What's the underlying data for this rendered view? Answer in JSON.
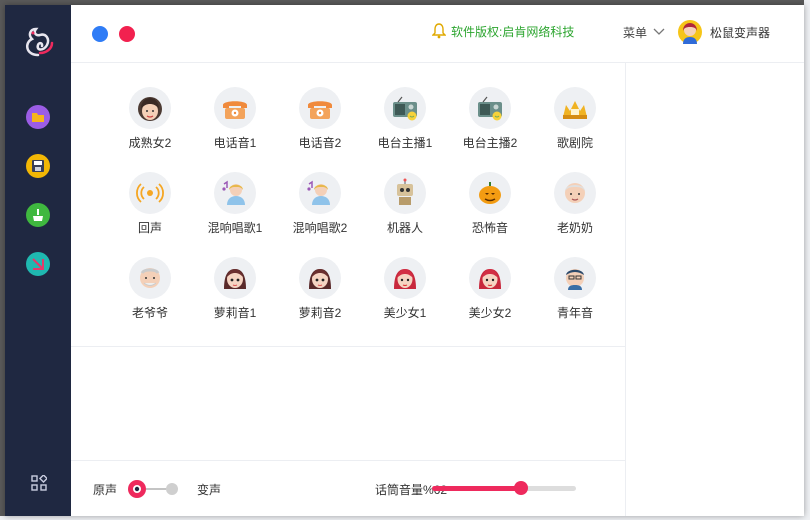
{
  "window": {
    "title": "松鼠变声器"
  },
  "titlebar": {
    "copyright": "软件版权:启肯网络科技",
    "menu_label": "菜单",
    "user_name": "松鼠变声器"
  },
  "sidebar": {
    "items": [
      {
        "name": "folder",
        "icon": "folder-icon",
        "color": "#9b5de5"
      },
      {
        "name": "save",
        "icon": "save-icon",
        "color": "#f2b705"
      },
      {
        "name": "clean",
        "icon": "broom-icon",
        "color": "#3fb83f"
      },
      {
        "name": "map",
        "icon": "map-icon",
        "color": "#1fb8b0"
      }
    ]
  },
  "effects": [
    {
      "label": "成熟女2",
      "icon": "woman-face-icon"
    },
    {
      "label": "电话音1",
      "icon": "telephone-icon"
    },
    {
      "label": "电话音2",
      "icon": "telephone-icon"
    },
    {
      "label": "电台主播1",
      "icon": "radio-icon"
    },
    {
      "label": "电台主播2",
      "icon": "radio-icon"
    },
    {
      "label": "歌剧院",
      "icon": "opera-house-icon"
    },
    {
      "label": "回声",
      "icon": "echo-icon"
    },
    {
      "label": "混响唱歌1",
      "icon": "singer-icon"
    },
    {
      "label": "混响唱歌2",
      "icon": "singer-icon"
    },
    {
      "label": "机器人",
      "icon": "robot-icon"
    },
    {
      "label": "恐怖音",
      "icon": "pumpkin-icon"
    },
    {
      "label": "老奶奶",
      "icon": "grandma-icon"
    },
    {
      "label": "老爷爷",
      "icon": "grandpa-icon"
    },
    {
      "label": "萝莉音1",
      "icon": "girl-icon"
    },
    {
      "label": "萝莉音2",
      "icon": "girl-icon"
    },
    {
      "label": "美少女1",
      "icon": "pretty-girl-icon"
    },
    {
      "label": "美少女2",
      "icon": "pretty-girl-icon"
    },
    {
      "label": "青年音",
      "icon": "young-man-icon"
    }
  ],
  "bottom": {
    "original_label": "原声",
    "changed_label": "变声",
    "volume_label": "话筒音量%62",
    "volume": 0.62
  },
  "colors": {
    "accent": "#ee2a5d",
    "blue_dot": "#2f7cf6",
    "red_dot": "#f2214f",
    "sidebar": "#1f2841",
    "copyright": "#2ca52f"
  }
}
